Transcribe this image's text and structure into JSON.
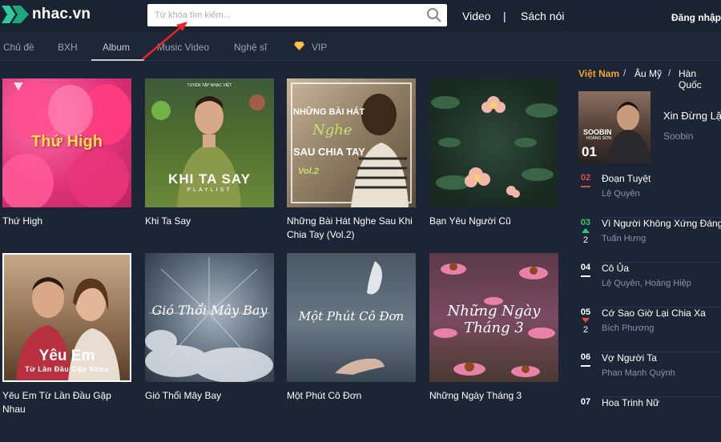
{
  "header": {
    "logo_text": "nhac.vn",
    "search_placeholder": "Từ khóa tìm kiếm...",
    "links": [
      "Video",
      "|",
      "Sách nói"
    ],
    "login": "Đăng nhập"
  },
  "nav": {
    "tabs": [
      "Chủ đề",
      "BXH",
      "Album",
      "Music Video",
      "Nghệ sĩ",
      "VIP"
    ],
    "active": "Album"
  },
  "albums": [
    {
      "title": "Thứ High",
      "cover_text": "Thứ High"
    },
    {
      "title": "Khi Ta Say",
      "cover_text": "KHI TA SAY",
      "cover_sub": "PLAYLIST",
      "cover_top": "TUYỂN TẬP NHẠC VIỆT"
    },
    {
      "title": "Những Bài Hát Nghe Sau Khi Chia Tay (Vol.2)",
      "cover_text": "NHỮNG BÀI HÁT",
      "cover_sub": "Nghe",
      "cover_sub2": "SAU CHIA TAY",
      "cover_vol": "Vol.2"
    },
    {
      "title": "Bạn Yêu Người Cũ",
      "cover_text": ""
    },
    {
      "title": "Yêu Em Từ Lần Đầu Gặp Nhau",
      "cover_text": "Yêu Em",
      "cover_sub": "Từ Lần Đầu Gặp Nhau"
    },
    {
      "title": "Gió Thổi Mây Bay",
      "cover_text": "Gió Thổi Mây Bay"
    },
    {
      "title": "Một Phút Cô Đơn",
      "cover_text": "Một Phút Cô Đơn"
    },
    {
      "title": "Những Ngày Tháng 3",
      "cover_text": "Những Ngày Tháng 3"
    }
  ],
  "sidebar": {
    "regions": [
      "Việt Nam",
      "Âu Mỹ",
      "Hàn Quốc"
    ],
    "active_region": "Việt Nam",
    "top": {
      "rank": "01",
      "title": "Xin Đừng Lặng Im",
      "artist": "Soobin",
      "cover_name": "SOOBIN",
      "cover_name2": "HOÀNG SƠN"
    },
    "ranks": [
      {
        "rank": "02",
        "song": "Đoạn Tuyệt",
        "artist": "Lệ Quyên",
        "trend": "none",
        "change": ""
      },
      {
        "rank": "03",
        "song": "Vì Người Không Xứng Đáng",
        "artist": "Tuấn Hưng",
        "trend": "up",
        "change": "2"
      },
      {
        "rank": "04",
        "song": "Cô Ủa",
        "artist": "Lệ Quyên, Hoàng Hiệp",
        "trend": "none",
        "change": ""
      },
      {
        "rank": "05",
        "song": "Cớ Sao Giờ Lại Chia Xa",
        "artist": "Bích Phương",
        "trend": "down",
        "change": "2"
      },
      {
        "rank": "06",
        "song": "Vợ Người Ta",
        "artist": "Phan Mạnh Quỳnh",
        "trend": "none",
        "change": ""
      },
      {
        "rank": "07",
        "song": "Hoa Trinh Nữ",
        "artist": "",
        "trend": "none",
        "change": ""
      }
    ]
  },
  "colors": {
    "accent": "#f5a623",
    "up": "#2ecc71",
    "down": "#e74c3c",
    "rank02": "#e74c3c",
    "logo": "#2ecc9a"
  }
}
